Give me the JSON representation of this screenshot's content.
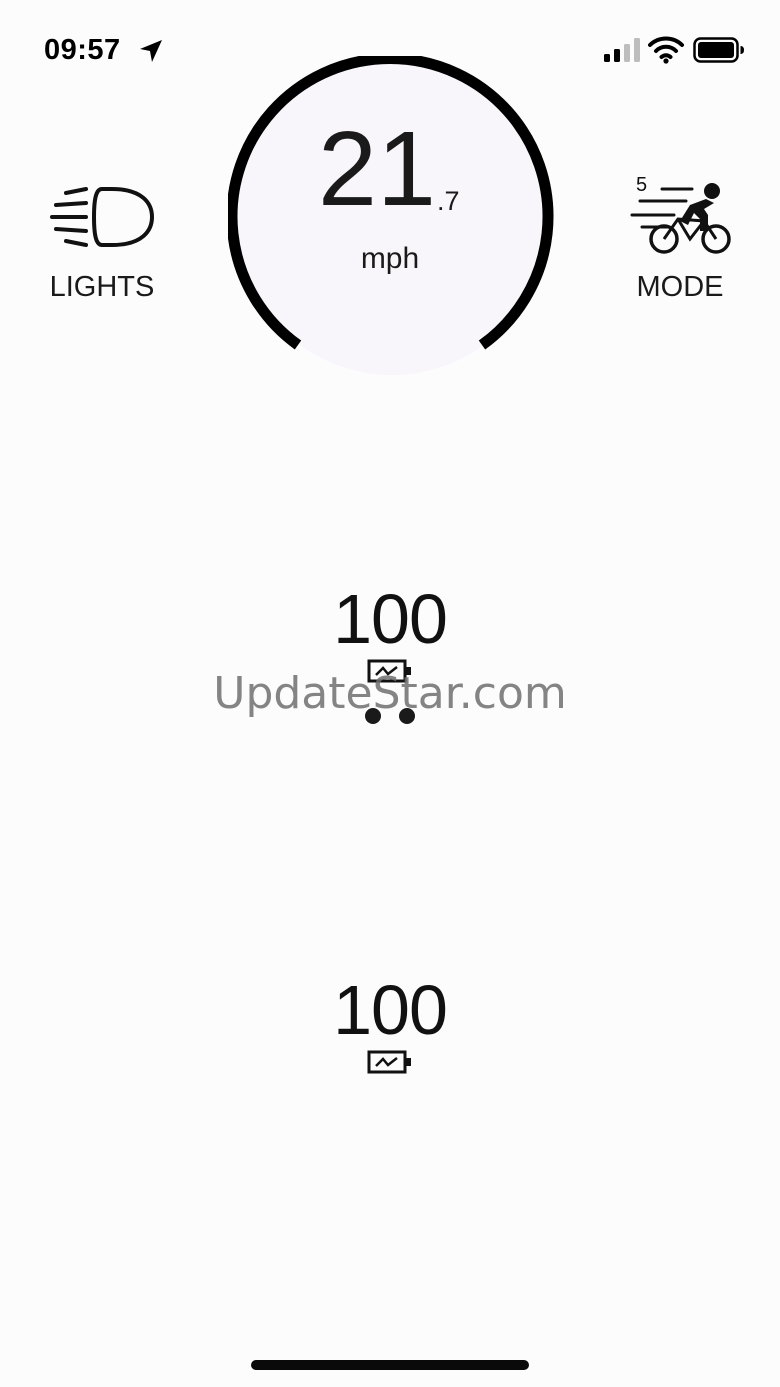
{
  "status_bar": {
    "time": "09:57",
    "icons": [
      "location-arrow-icon",
      "cellular-signal-icon",
      "wifi-icon",
      "battery-full-icon"
    ]
  },
  "speedometer": {
    "speed_whole": "21",
    "speed_decimal": ".7",
    "unit": "mph"
  },
  "lights": {
    "label": "LIGHTS",
    "icon": "headlight-icon"
  },
  "mode": {
    "label": "MODE",
    "level": "5",
    "icon": "cyclist-speed-icon"
  },
  "batteries": [
    {
      "value": "100",
      "icon": "battery-charging-icon"
    },
    {
      "value": "100",
      "icon": "battery-charging-icon"
    }
  ],
  "pager": {
    "count": 2
  },
  "watermark": "UpdateStar.com",
  "colors": {
    "foreground": "#141414",
    "background": "#fcfcfd",
    "dial_fill": "#f8f5fb"
  }
}
